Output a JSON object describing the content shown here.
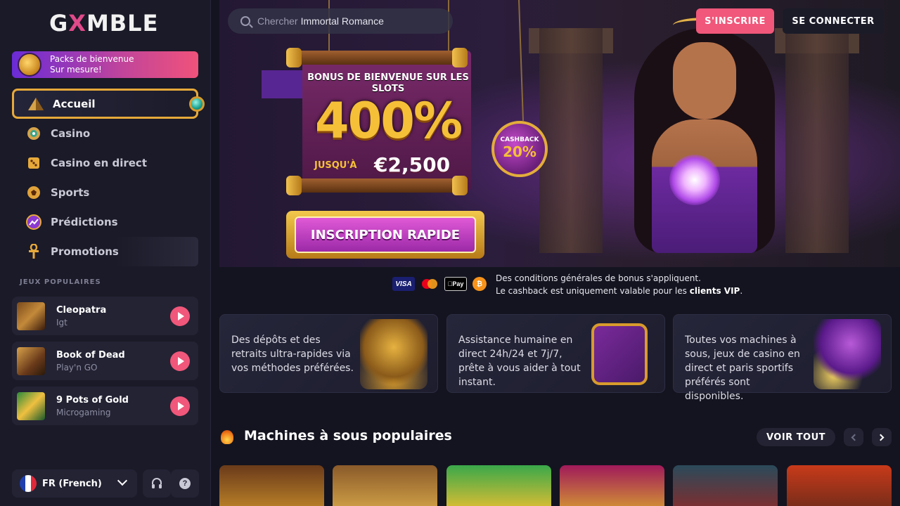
{
  "brand": {
    "logo_pre": "G",
    "logo_x": "X",
    "logo_post": "MBLE"
  },
  "sidebar": {
    "promo": {
      "line1": "Packs de bienvenue",
      "line2": "Sur mesure!"
    },
    "items": [
      {
        "label": "Accueil",
        "icon": "pyramid-icon"
      },
      {
        "label": "Casino",
        "icon": "chip-icon"
      },
      {
        "label": "Casino en direct",
        "icon": "dice-icon"
      },
      {
        "label": "Sports",
        "icon": "ball-icon"
      },
      {
        "label": "Prédictions",
        "icon": "trend-icon"
      },
      {
        "label": "Promotions",
        "icon": "ankh-icon"
      }
    ],
    "popular_label": "JEUX POPULAIRES",
    "popular": [
      {
        "name": "Cleopatra",
        "provider": "Igt"
      },
      {
        "name": "Book of Dead",
        "provider": "Play'n GO"
      },
      {
        "name": "9 Pots of Gold",
        "provider": "Microgaming"
      }
    ],
    "language": "FR (French)"
  },
  "header": {
    "search_placeholder": "Chercher",
    "search_value": "Immortal Romance",
    "register": "S'INSCRIRE",
    "login": "SE CONNECTER"
  },
  "hero": {
    "heading": "BONUS DE BIENVENUE SUR LES SLOTS",
    "big": "400%",
    "upto": "JUSQU'À",
    "amount": "€2,500",
    "cashback_label": "CASHBACK",
    "cashback_value": "20%",
    "cta": "INSCRIPTION RAPIDE"
  },
  "payments": [
    "VISA",
    "mastercard",
    "Pay",
    "₿"
  ],
  "terms": {
    "line1": "Des conditions générales de bonus s'appliquent.",
    "line2_pre": "Le cashback est uniquement valable pour les ",
    "line2_bold": "clients VIP",
    "line2_post": "."
  },
  "features": [
    {
      "text": "Des dépôts et des retraits ultra-rapides via vos méthodes préférées.",
      "art": "pharaoh-icon"
    },
    {
      "text": "Assistance humaine en direct 24h/24 et 7j/7, prête à vous aider à tout instant.",
      "art": "book-icon"
    },
    {
      "text": "Toutes vos machines à sous, jeux de casino en direct et paris sportifs préférés sont disponibles.",
      "art": "cat-icon"
    }
  ],
  "section": {
    "title": "Machines à sous populaires",
    "see_all": "VOIR TOUT"
  },
  "colors": {
    "accent": "#f0577a",
    "gold": "#e6a93a",
    "bg": "#141420",
    "panel": "#232334"
  }
}
